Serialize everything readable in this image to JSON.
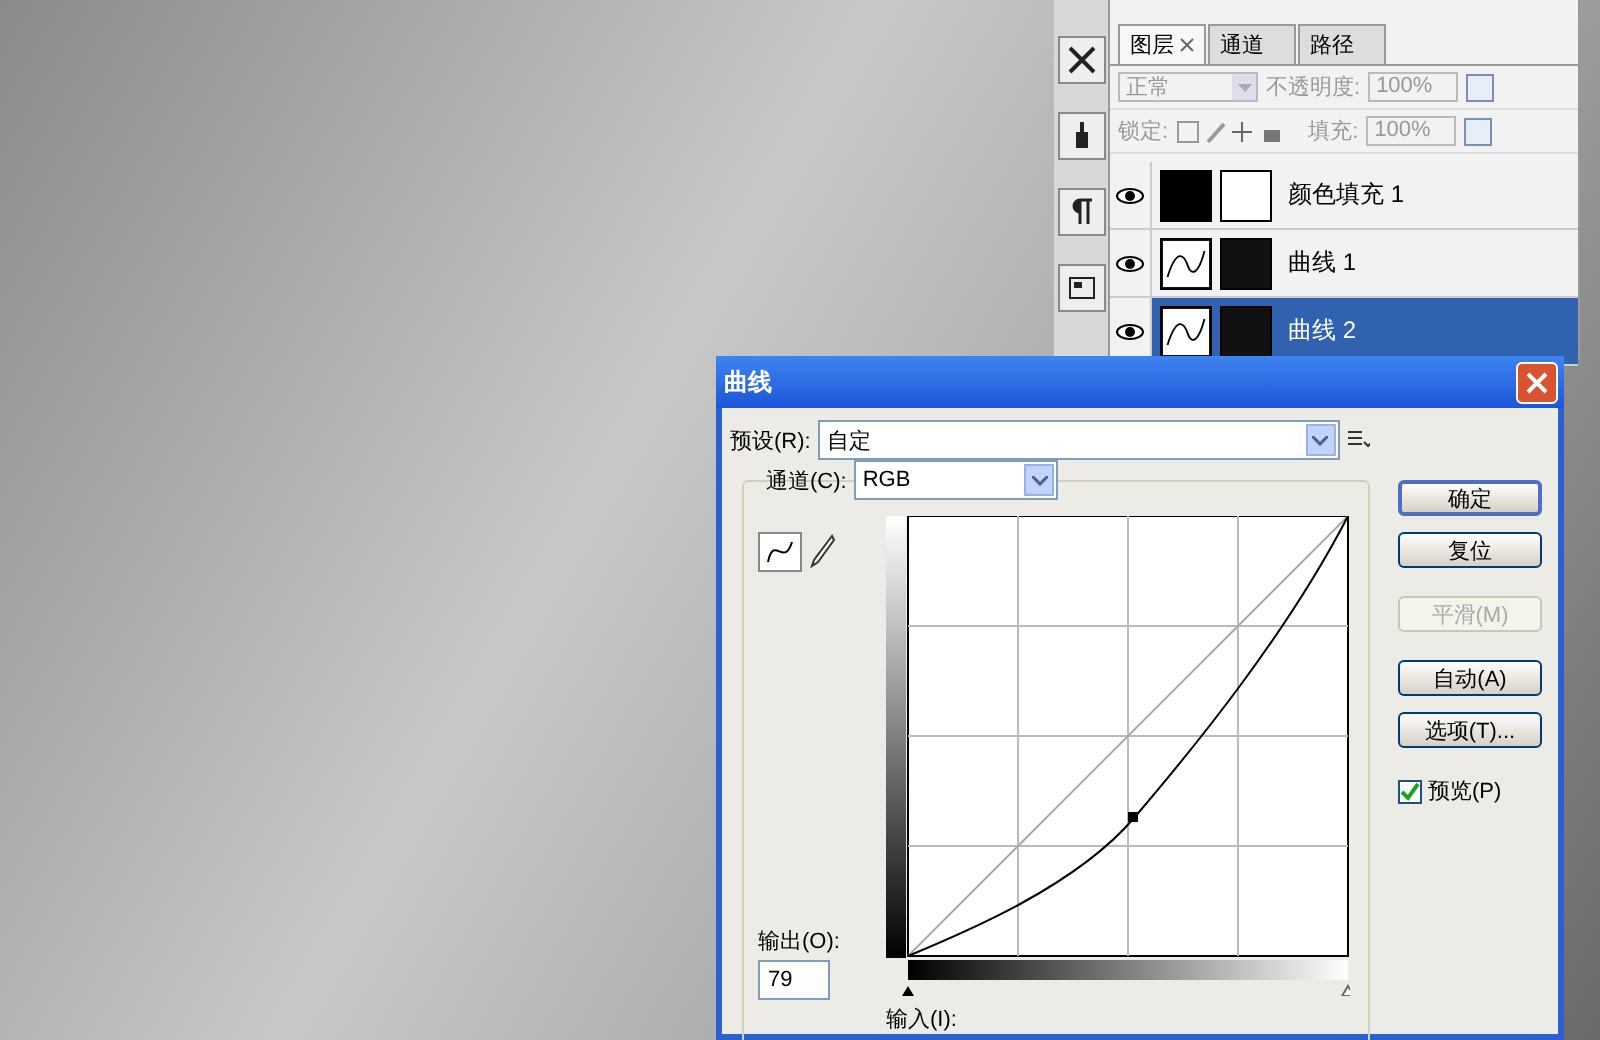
{
  "layers_panel": {
    "tabs": [
      {
        "label": "图层",
        "closable": true,
        "selected": true
      },
      {
        "label": "通道",
        "closable": false,
        "selected": false
      },
      {
        "label": "路径",
        "closable": false,
        "selected": false
      }
    ],
    "blend_mode": {
      "value": "正常",
      "disabled": true
    },
    "opacity": {
      "label": "不透明度:",
      "value": "100%",
      "disabled": true
    },
    "lock": {
      "label": "锁定:"
    },
    "fill": {
      "label": "填充:",
      "value": "100%",
      "disabled": true
    },
    "layers": [
      {
        "name": "颜色填充 1",
        "kind": "fill",
        "visible": true,
        "selected": false
      },
      {
        "name": "曲线 1",
        "kind": "curves",
        "visible": true,
        "selected": false
      },
      {
        "name": "曲线 2",
        "kind": "curves",
        "visible": true,
        "selected": true
      }
    ]
  },
  "dialog": {
    "title": "曲线",
    "preset": {
      "label": "预设(R):",
      "value": "自定"
    },
    "channel": {
      "label": "通道(C):",
      "value": "RGB"
    },
    "output": {
      "label": "输出(O):",
      "value": "79"
    },
    "input": {
      "label": "输入(I):"
    },
    "buttons": [
      {
        "label": "确定",
        "is_default": true,
        "disabled": false
      },
      {
        "label": "复位",
        "is_default": false,
        "disabled": false
      },
      {
        "label": "平滑(M)",
        "is_default": false,
        "disabled": true
      },
      {
        "label": "自动(A)",
        "is_default": false,
        "disabled": false
      },
      {
        "label": "选项(T)...",
        "is_default": false,
        "disabled": false
      }
    ],
    "preview": {
      "label": "预览(P)",
      "checked": true
    }
  }
}
